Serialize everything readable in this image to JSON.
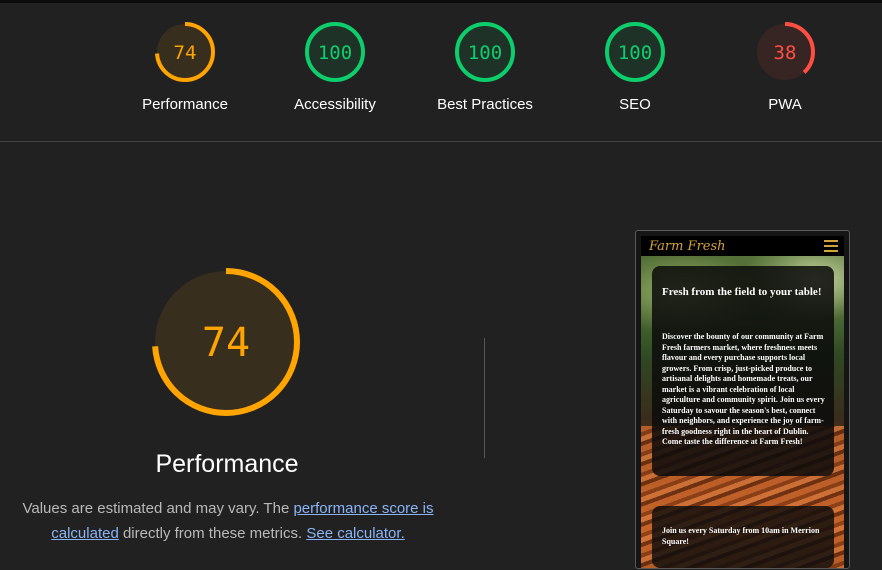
{
  "colors": {
    "average": "#ffa400",
    "pass": "#0cce6b",
    "fail": "#ff4e42"
  },
  "gauges": [
    {
      "score": "74",
      "label": "Performance",
      "value": 0.74,
      "rating": "average"
    },
    {
      "score": "100",
      "label": "Accessibility",
      "value": 1.0,
      "rating": "pass"
    },
    {
      "score": "100",
      "label": "Best Practices",
      "value": 1.0,
      "rating": "pass"
    },
    {
      "score": "100",
      "label": "SEO",
      "value": 1.0,
      "rating": "pass"
    },
    {
      "score": "38",
      "label": "PWA",
      "value": 0.38,
      "rating": "fail"
    }
  ],
  "category": {
    "score": "74",
    "value": 0.74,
    "title": "Performance",
    "desc_prefix": "Values are estimated and may vary. The ",
    "desc_link1": "performance score is calculated",
    "desc_middle": " directly from these metrics. ",
    "desc_link2": "See calculator."
  },
  "screenshot": {
    "brand": "Farm Fresh",
    "menu_icon": "hamburger-icon",
    "hero_title": "Fresh from the field to your table!",
    "hero_text": "Discover the bounty of our community at Farm Fresh farmers market, where freshness meets flavour and every purchase supports local growers. From crisp, just-picked produce to artisanal delights and homemade treats, our market is a vibrant celebration of local agriculture and community spirit. Join us every Saturday to savour the season's best, connect with neighbors, and experience the joy of farm-fresh goodness right in the heart of Dublin. Come taste the difference at Farm Fresh!",
    "bottom_text": "Join us every Saturday from 10am in Merrion Square!"
  }
}
